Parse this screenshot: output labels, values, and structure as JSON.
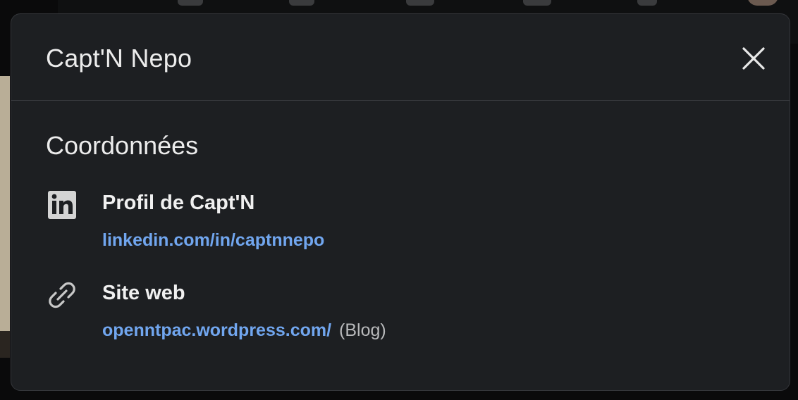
{
  "modal": {
    "title": "Capt'N Nepo",
    "close_icon": "close-icon"
  },
  "section": {
    "title": "Coordonnées"
  },
  "contacts": [
    {
      "icon": "linkedin-icon",
      "label": "Profil de Capt'N",
      "link": "linkedin.com/in/captnnepo",
      "note": ""
    },
    {
      "icon": "link-icon",
      "label": "Site web",
      "link": "openntpac.wordpress.com/",
      "note": "(Blog)"
    }
  ],
  "colors": {
    "modal_bg": "#1d1f22",
    "text": "#ececec",
    "link": "#71a6ef",
    "muted": "#b8b9bb",
    "divider": "#3a3c40"
  }
}
